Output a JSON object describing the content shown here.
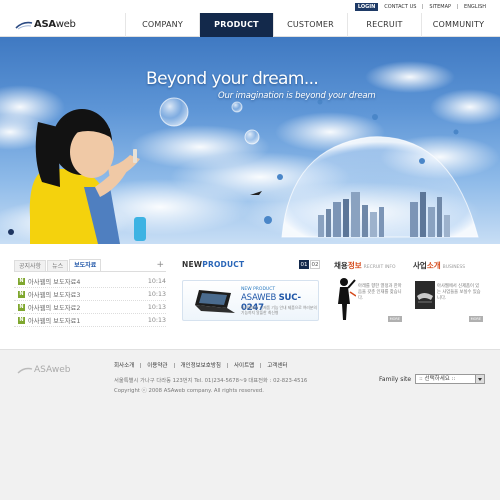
{
  "utility": {
    "login": "LOGIN",
    "links": [
      "CONTACT US",
      "SITEMAP",
      "ENGLISH"
    ]
  },
  "brand": {
    "bold": "ASA",
    "rest": "web"
  },
  "nav": [
    "COMPANY",
    "PRODUCT",
    "CUSTOMER",
    "RECRUIT",
    "COMMUNITY"
  ],
  "nav_active": "PRODUCT",
  "hero": {
    "headline": "Beyond your dream...",
    "subline": "Our imagination is beyond your dream"
  },
  "board": {
    "tabs": [
      "공지사항",
      "뉴스",
      "보도자료"
    ],
    "active_tab": "보도자료",
    "items": [
      {
        "title": "아사웹의 보도자료4",
        "time": "10:14"
      },
      {
        "title": "아사웹의 보도자료3",
        "time": "10:13"
      },
      {
        "title": "아사웹의 보도자료2",
        "time": "10:13"
      },
      {
        "title": "아사웹의 보도자료1",
        "time": "10:13"
      }
    ]
  },
  "new_product": {
    "title_a": "NEW",
    "title_b": "PRODUCT",
    "pages": [
      "01",
      "02"
    ],
    "card": {
      "label": "NEW PRODUCT",
      "name_a": "ASAWEB ",
      "name_b": "SUC-0247",
      "desc": "아사웹에서 신제품 기능 안내 제품으로 여러분의 기능까지 알뜰한 최신형"
    }
  },
  "recruit": {
    "title_a": "채용",
    "title_b": "정보",
    "en": "RECRUIT INFO",
    "text": "아래를 향한 열정과 한마음을 갖춘 인재를 찾습니다.",
    "more": "MORE"
  },
  "business": {
    "title_a": "사업",
    "title_b": "소개",
    "en": "BUSINESS",
    "text": "아사웹에서 신제품이 있는 사업들을 보실수 있습니다.",
    "more": "MORE"
  },
  "footer": {
    "logo": "ASAweb",
    "links": [
      "회사소개",
      "이용약관",
      "개인정보보호방침",
      "사이트맵",
      "고객센터"
    ],
    "address": "서울특별시 가나구 다라동 123번지 Tel. 01)234-5678~9 대표전화 : 02-823-4516",
    "copyright": "Copyright ⓒ 2008 ASAweb company. All rights reserved.",
    "family_label": "Family site",
    "family_value": ":: 선택하세요 ::"
  }
}
